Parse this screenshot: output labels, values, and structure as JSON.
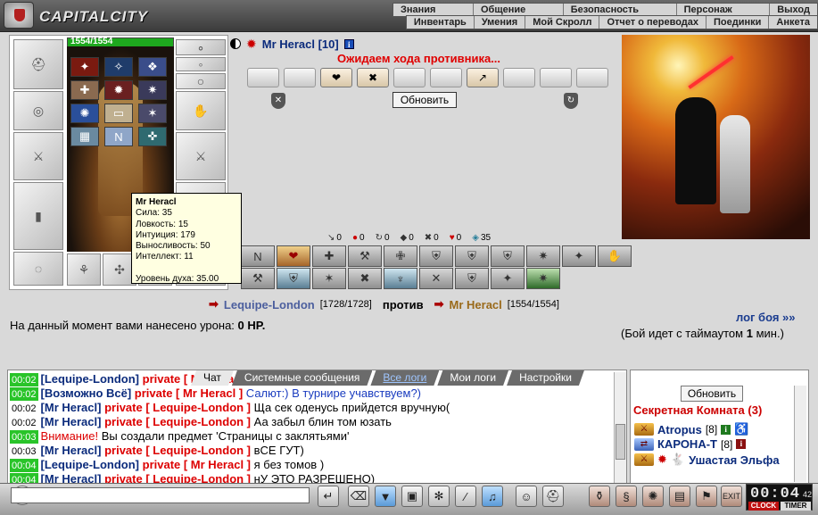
{
  "app": {
    "logo_text": "CAPITALCITY"
  },
  "menu": {
    "top": [
      "Знания",
      "Общение",
      "Безопасность",
      "Персонаж",
      "Выход"
    ],
    "sub": [
      "Инвентарь",
      "Умения",
      "Мой Скролл",
      "Отчет о переводах",
      "Поединки",
      "Анкета"
    ]
  },
  "character": {
    "hp_text": "1554/1554",
    "hp_fraction": 1.0,
    "tooltip": {
      "name": "Mr Heracl",
      "strength": "Сила: 35",
      "agility": "Ловкость: 15",
      "intuition": "Интуиция: 179",
      "endurance": "Выносливость: 50",
      "intellect": "Интеллект: 11",
      "spirit": "Уровень духа: 35.00"
    }
  },
  "fight": {
    "player_name": "Mr Heracl [10]",
    "waiting": "Ожидаем хода противника...",
    "refresh_label": "Обновить",
    "counters": [
      "0",
      "0",
      "0",
      "0",
      "0",
      "0",
      "35"
    ],
    "opponent_name": "Lequipe-London",
    "opponent_hp": "[1728/1728]",
    "vs_label": "против",
    "self_name": "Mr Heracl",
    "self_hp": "[1554/1554]",
    "damage_text": "На данный момент вами нанесено урона:",
    "damage_value": "0 HP.",
    "battle_log_link": "лог боя »»",
    "timeout_prefix": "(Бой идет с таймаутом",
    "timeout_value": "1",
    "timeout_suffix": "мин.)"
  },
  "chat": {
    "tabs": [
      "Чат",
      "Системные сообщения",
      "Все логи",
      "Мои логи",
      "Настройки"
    ],
    "lines": [
      {
        "time": "00:02",
        "who": "[Lequipe-London]",
        "to": "private [ Mr Heracl ]",
        "msg": ""
      },
      {
        "time": "00:02",
        "who": "[Возможно Всё]",
        "to": "private [ Mr Heracl ]",
        "msg": "Салют:) В турнире учавствуем?)"
      },
      {
        "time": "00:02",
        "who": "[Mr Heracl]",
        "to": "private [ Lequipe-London ]",
        "msg": "Ща сек оденусь прийдется вручную("
      },
      {
        "time": "00:02",
        "who": "[Mr Heracl]",
        "to": "private [ Lequipe-London ]",
        "msg": "Аа забыл блин том юзать"
      },
      {
        "time": "00:03",
        "warn": "Внимание!",
        "msg": "Вы создали предмет 'Страницы с заклятьями'"
      },
      {
        "time": "00:03",
        "who": "[Mr Heracl]",
        "to": "private [ Lequipe-London ]",
        "msg": "вСЕ ГУТ)"
      },
      {
        "time": "00:04",
        "who": "[Lequipe-London]",
        "to": "private [ Mr Heracl ]",
        "msg": "я без томов )"
      },
      {
        "time": "00:04",
        "who": "[Mr Heracl]",
        "to": "private [ Lequipe-London ]",
        "msg": "нУ ЭТО РАЗРЕШЕНО)"
      }
    ]
  },
  "room": {
    "refresh_label": "Обновить",
    "title": "Секретная Комната (3)",
    "users": [
      {
        "name": "Atropus",
        "level": "[8]"
      },
      {
        "name": "КАРОНА-Т",
        "level": "[8]"
      },
      {
        "name": "Ушастая Эльфа",
        "level": ""
      }
    ]
  },
  "clock": {
    "time": "00:04",
    "seconds": "42",
    "clock_label": "CLOCK",
    "timer_label": "TIMER"
  },
  "colors": {
    "accent_red": "#d00000",
    "name_blue": "#0b2b7c",
    "time_green": "#29c429"
  }
}
